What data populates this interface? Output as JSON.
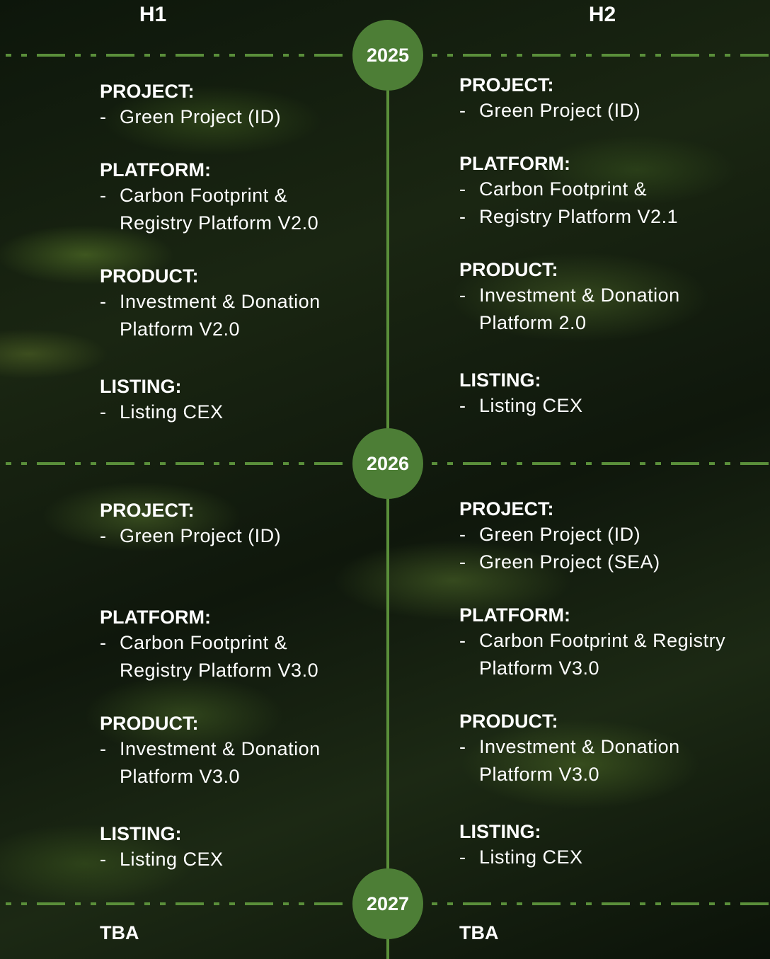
{
  "headers": {
    "h1": "H1",
    "h2": "H2"
  },
  "years": [
    "2025",
    "2026",
    "2027"
  ],
  "y2025": {
    "h1": [
      {
        "heading": "PROJECT:",
        "items": [
          [
            "- ",
            "Green Project (ID)"
          ]
        ]
      },
      {
        "heading": "PLATFORM:",
        "items": [
          [
            "- ",
            "Carbon Footprint &"
          ],
          [
            "",
            "Registry Platform V2.0"
          ]
        ]
      },
      {
        "heading": "PRODUCT:",
        "items": [
          [
            "- ",
            "Investment & Donation"
          ],
          [
            "",
            "Platform V2.0"
          ]
        ]
      },
      {
        "heading": "LISTING:",
        "items": [
          [
            "- ",
            "Listing CEX"
          ]
        ]
      }
    ],
    "h2": [
      {
        "heading": "PROJECT:",
        "items": [
          [
            "- ",
            "Green Project (ID)"
          ]
        ]
      },
      {
        "heading": "PLATFORM:",
        "items": [
          [
            "- ",
            "Carbon Footprint &"
          ],
          [
            "- ",
            "Registry Platform V2.1"
          ]
        ]
      },
      {
        "heading": "PRODUCT:",
        "items": [
          [
            "- ",
            "Investment & Donation"
          ],
          [
            "",
            "Platform 2.0"
          ]
        ]
      },
      {
        "heading": "LISTING:",
        "items": [
          [
            "- ",
            "Listing CEX"
          ]
        ]
      }
    ]
  },
  "y2026": {
    "h1": [
      {
        "heading": "PROJECT:",
        "items": [
          [
            "- ",
            "Green Project (ID)"
          ]
        ]
      },
      {
        "heading": "PLATFORM:",
        "items": [
          [
            "- ",
            "Carbon Footprint &"
          ],
          [
            "",
            "Registry Platform V3.0"
          ]
        ]
      },
      {
        "heading": "PRODUCT:",
        "items": [
          [
            "- ",
            "Investment & Donation"
          ],
          [
            "",
            "Platform V3.0"
          ]
        ]
      },
      {
        "heading": "LISTING:",
        "items": [
          [
            "- ",
            "Listing CEX"
          ]
        ]
      }
    ],
    "h2": [
      {
        "heading": "PROJECT:",
        "items": [
          [
            "- ",
            "Green Project (ID)"
          ],
          [
            "- ",
            "Green Project (SEA)"
          ]
        ]
      },
      {
        "heading": "PLATFORM:",
        "items": [
          [
            "- ",
            "Carbon Footprint & Registry"
          ],
          [
            "",
            "Platform V3.0"
          ]
        ]
      },
      {
        "heading": "PRODUCT:",
        "items": [
          [
            "- ",
            "Investment & Donation"
          ],
          [
            "",
            "Platform V3.0"
          ]
        ]
      },
      {
        "heading": "LISTING:",
        "items": [
          [
            "- ",
            "Listing CEX"
          ]
        ]
      }
    ]
  },
  "y2027": {
    "h1": "TBA",
    "h2": "TBA"
  },
  "colors": {
    "accent": "#4d7e36",
    "line": "#5a8f3a"
  }
}
